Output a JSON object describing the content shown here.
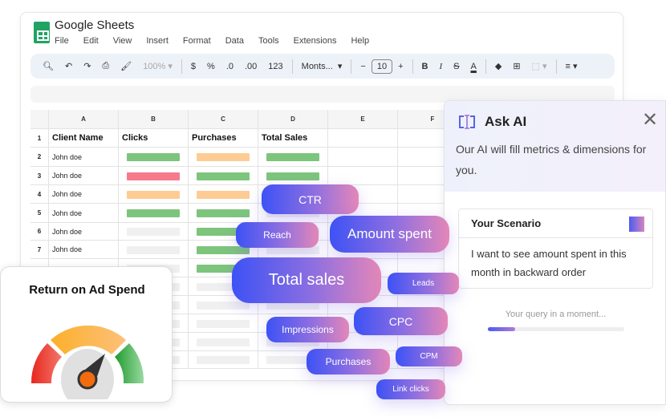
{
  "app": {
    "title": "Google Sheets",
    "menu": [
      "File",
      "Edit",
      "View",
      "Insert",
      "Format",
      "Data",
      "Tools",
      "Extensions",
      "Help"
    ]
  },
  "toolbar": {
    "zoom": "100%",
    "currency": "$",
    "percent": "%",
    "dec_decrease": ".0",
    "dec_increase": ".00",
    "number_format": "123",
    "font": "Monts...",
    "font_size": "10",
    "bold": "B",
    "italic": "I",
    "text_color": "A"
  },
  "grid": {
    "columns": [
      "A",
      "B",
      "C",
      "D",
      "E",
      "F"
    ],
    "headers": [
      "Client Name",
      "Clicks",
      "Purchases",
      "Total Sales"
    ],
    "rows": [
      "1",
      "2",
      "3",
      "4",
      "5",
      "6",
      "7"
    ],
    "client_names": [
      "John doe",
      "John doe",
      "John doe",
      "John doe",
      "John doe",
      "John doe"
    ],
    "status_colors": {
      "green": "#7dc57d",
      "red": "#f57b8b",
      "orange": "#ffcb94",
      "empty": "#f0f0f0"
    },
    "bars": [
      [
        "green",
        "orange",
        "green"
      ],
      [
        "red",
        "green",
        "green"
      ],
      [
        "orange",
        "orange",
        "empty"
      ],
      [
        "green",
        "green",
        "empty"
      ],
      [
        "empty",
        "green",
        "empty"
      ],
      [
        "empty",
        "green",
        "empty"
      ],
      [
        "empty",
        "green",
        "empty"
      ]
    ]
  },
  "roas_card": {
    "title": "Return on Ad Spend",
    "gauge_level": "high"
  },
  "metric_pills": [
    "CTR",
    "Reach",
    "Amount spent",
    "Total sales",
    "Leads",
    "CPC",
    "Impressions",
    "Purchases",
    "CPM",
    "Link clicks"
  ],
  "ask_ai": {
    "title": "Ask AI",
    "subtitle": "Our AI will fill metrics & dimensions for you.",
    "scenario_label": "Your Scenario",
    "scenario_text": "I want to see amount spent in this month in backward order",
    "status": "Your query in a moment...",
    "progress": 0.2,
    "accent": "#4a5cf0"
  }
}
